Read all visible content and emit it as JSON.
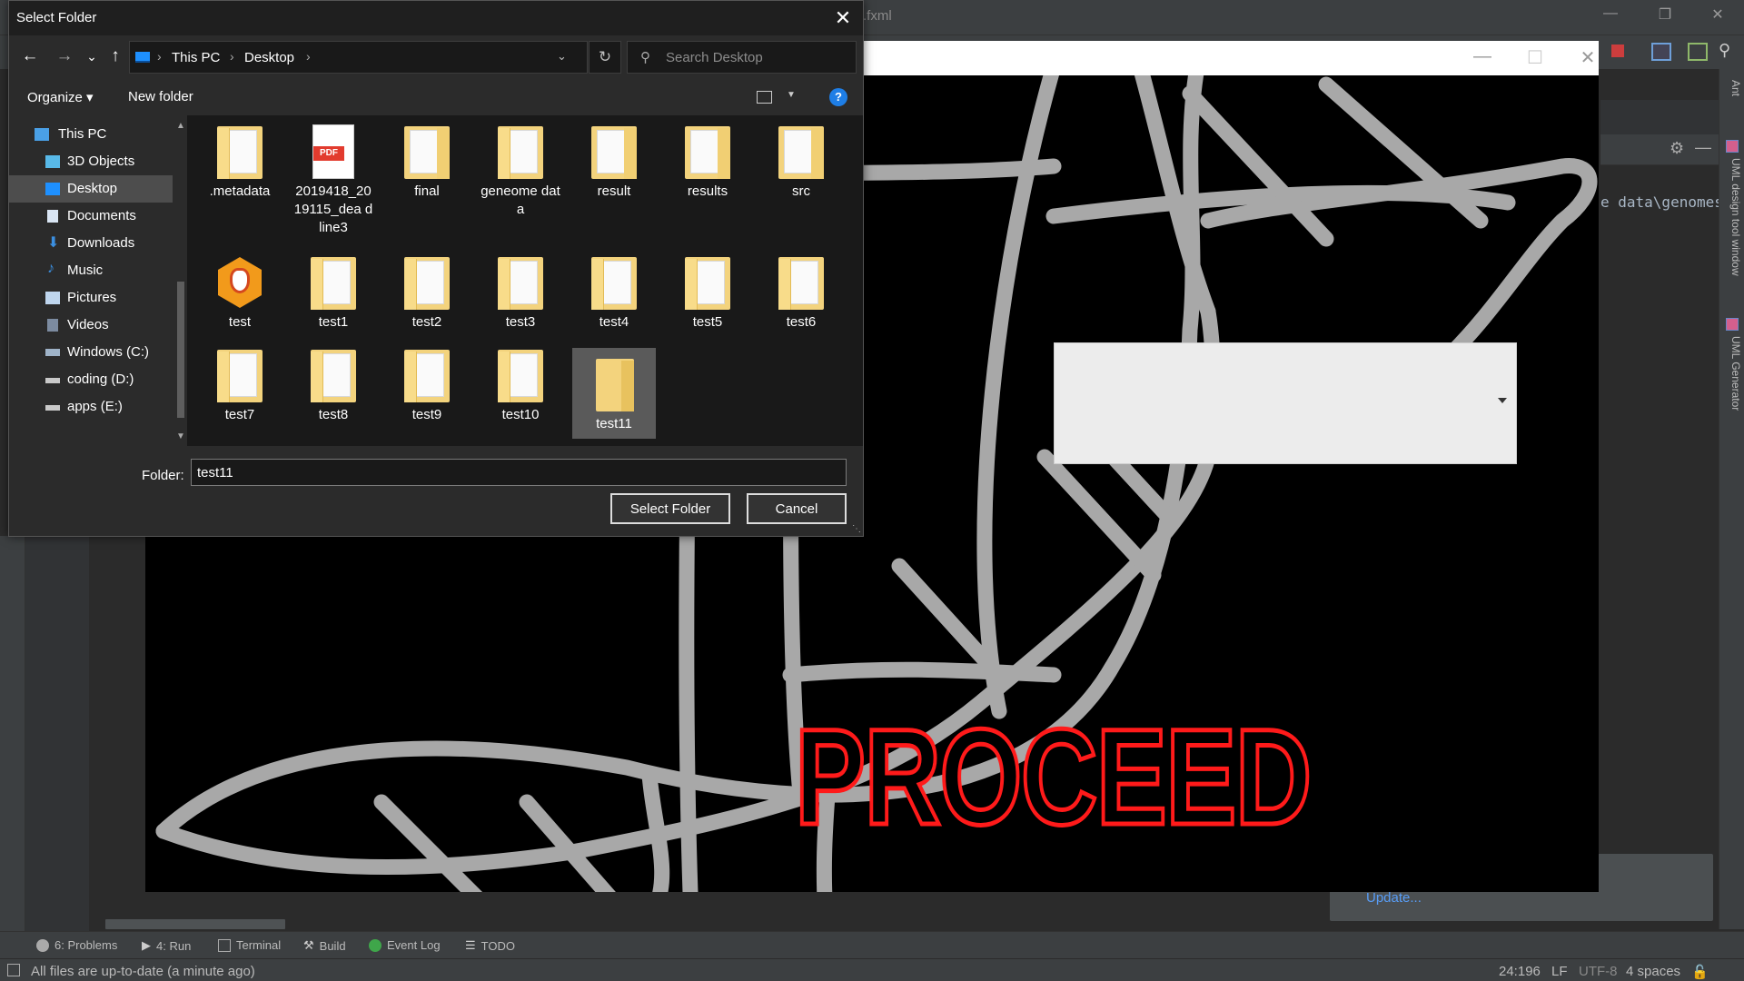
{
  "ide": {
    "title_fragment": ".fxml",
    "window_controls": {
      "minimize": "—",
      "restore": "❐",
      "close": "✕"
    },
    "code_snippet": "e data\\genomes",
    "right_tabs": [
      "Ant",
      "UML design tool window",
      "UML Generator"
    ],
    "notification_link": "Update...",
    "bottom_tabs": [
      {
        "icon": "problems-icon",
        "label": "6: Problems"
      },
      {
        "icon": "run-icon",
        "label": "4: Run"
      },
      {
        "icon": "terminal-icon",
        "label": "Terminal"
      },
      {
        "icon": "build-icon",
        "label": "Build"
      },
      {
        "icon": "event-log-icon",
        "label": "Event Log"
      },
      {
        "icon": "todo-icon",
        "label": "TODO"
      }
    ],
    "status": {
      "message": "All files are up-to-date (a minute ago)",
      "position": "24:196",
      "line_sep": "LF",
      "encoding": "UTF-8",
      "indent": "4 spaces"
    },
    "colors": {
      "bg": "#2b2b2b",
      "panel": "#3c3f41",
      "link": "#589df6"
    }
  },
  "app": {
    "window_controls": {
      "minimize": "—",
      "maximize": "☐",
      "close": "✕"
    },
    "proceed_text": "PROCEED",
    "colors": {
      "proceed_outline": "#ff1a1a",
      "bg": "#000000",
      "lines": "#a8a8a8"
    }
  },
  "dialog": {
    "title": "Select Folder",
    "close_glyph": "✕",
    "nav": {
      "back": "←",
      "forward": "→",
      "recent": "⌄",
      "up": "↑"
    },
    "address": {
      "segments": [
        "This PC",
        "Desktop"
      ],
      "separator": "›"
    },
    "refresh_glyph": "↻",
    "search_placeholder": "Search Desktop",
    "commands": {
      "organize": "Organize ▾",
      "new_folder": "New folder",
      "help": "?"
    },
    "nav_pane": [
      {
        "label": "This PC",
        "icon": "pc-icon",
        "selected": false
      },
      {
        "label": "3D Objects",
        "icon": "3d-objects-icon",
        "selected": false
      },
      {
        "label": "Desktop",
        "icon": "desktop-icon",
        "selected": true
      },
      {
        "label": "Documents",
        "icon": "documents-icon",
        "selected": false
      },
      {
        "label": "Downloads",
        "icon": "downloads-icon",
        "selected": false
      },
      {
        "label": "Music",
        "icon": "music-icon",
        "selected": false
      },
      {
        "label": "Pictures",
        "icon": "pictures-icon",
        "selected": false
      },
      {
        "label": "Videos",
        "icon": "videos-icon",
        "selected": false
      },
      {
        "label": "Windows (C:)",
        "icon": "drive-icon",
        "selected": false
      },
      {
        "label": "coding (D:)",
        "icon": "drive-icon",
        "selected": false
      },
      {
        "label": "apps (E:)",
        "icon": "drive-icon",
        "selected": false
      }
    ],
    "files": [
      {
        "name": ".metadata",
        "kind": "folder"
      },
      {
        "name": "2019418_20 19115_dea dline3",
        "kind": "pdf"
      },
      {
        "name": "final",
        "kind": "folder"
      },
      {
        "name": "geneome data",
        "kind": "folder"
      },
      {
        "name": "result",
        "kind": "folder"
      },
      {
        "name": "results",
        "kind": "folder"
      },
      {
        "name": "src",
        "kind": "folder"
      },
      {
        "name": "test",
        "kind": "app"
      },
      {
        "name": "test1",
        "kind": "folder"
      },
      {
        "name": "test2",
        "kind": "folder"
      },
      {
        "name": "test3",
        "kind": "folder"
      },
      {
        "name": "test4",
        "kind": "folder"
      },
      {
        "name": "test5",
        "kind": "folder"
      },
      {
        "name": "test6",
        "kind": "folder"
      },
      {
        "name": "test7",
        "kind": "folder"
      },
      {
        "name": "test8",
        "kind": "folder"
      },
      {
        "name": "test9",
        "kind": "folder"
      },
      {
        "name": "test10",
        "kind": "folder"
      },
      {
        "name": "test11",
        "kind": "folder-empty",
        "selected": true
      }
    ],
    "folder_label": "Folder:",
    "folder_value": "test11",
    "buttons": {
      "select": "Select Folder",
      "cancel": "Cancel"
    },
    "colors": {
      "bg": "#2b2b2b",
      "files_bg": "#191919",
      "folder": "#f3d37d",
      "selection": "#5a5a5a",
      "accent": "#1e7ee6"
    }
  }
}
